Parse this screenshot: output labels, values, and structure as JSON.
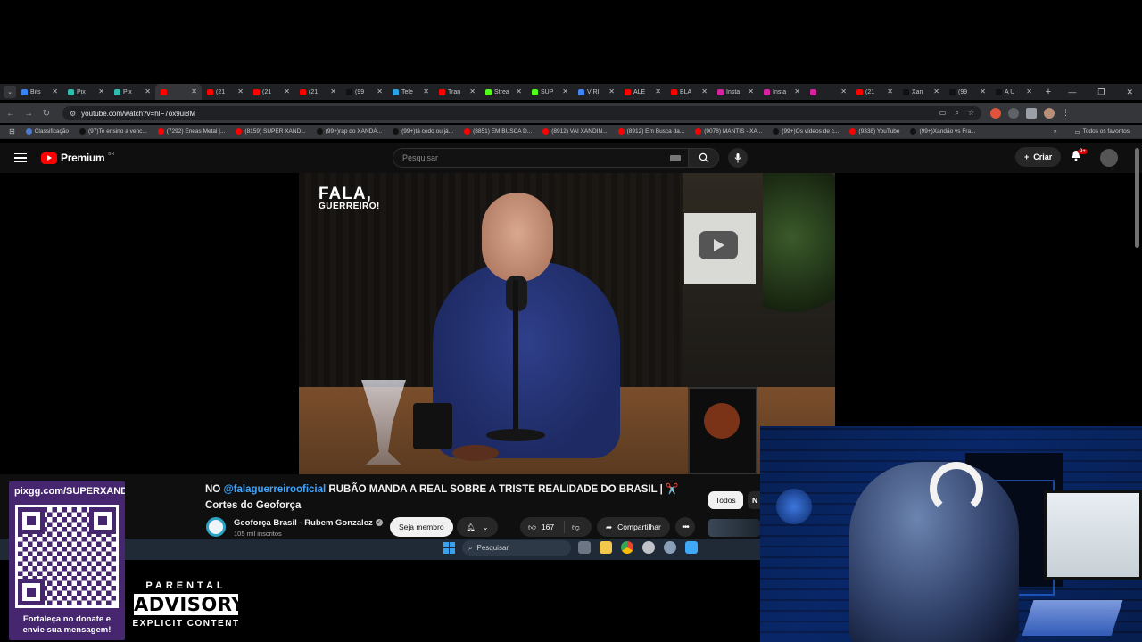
{
  "browser": {
    "tabs": [
      {
        "label": "Bits",
        "fav": "#3b82f6"
      },
      {
        "label": "Pix",
        "fav": "#32bcad"
      },
      {
        "label": "Pix",
        "fav": "#32bcad"
      },
      {
        "label": "",
        "fav": "#ff0000",
        "active": true
      },
      {
        "label": "(21",
        "fav": "#ff0000"
      },
      {
        "label": "(21",
        "fav": "#ff0000"
      },
      {
        "label": "(21",
        "fav": "#ff0000"
      },
      {
        "label": "(99",
        "fav": "#111111"
      },
      {
        "label": "Tele",
        "fav": "#2aa3e0"
      },
      {
        "label": "Tran",
        "fav": "#ff0000"
      },
      {
        "label": "Strea",
        "fav": "#53fc18"
      },
      {
        "label": "SUP",
        "fav": "#53fc18"
      },
      {
        "label": "VIRI",
        "fav": "#4285f4"
      },
      {
        "label": "ALE",
        "fav": "#ff0000"
      },
      {
        "label": "BLA",
        "fav": "#ff0000"
      },
      {
        "label": "Insta",
        "fav": "#d6249f"
      },
      {
        "label": "Insta",
        "fav": "#d6249f"
      },
      {
        "label": "",
        "fav": "#d6249f"
      },
      {
        "label": "(21",
        "fav": "#ff0000"
      },
      {
        "label": "Xan",
        "fav": "#111111"
      },
      {
        "label": "(99",
        "fav": "#111111"
      },
      {
        "label": "A Ú",
        "fav": "#111111"
      }
    ],
    "url": "youtube.com/watch?v=hlF7ox9ui8M",
    "bookmarks": [
      {
        "label": "Classificação",
        "color": "#4a7bd0"
      },
      {
        "label": "(97)Te ensino a venc...",
        "color": "#111111"
      },
      {
        "label": "(7292) Enéas Metal |...",
        "color": "#ff0000"
      },
      {
        "label": "(8159) SUPER XAND...",
        "color": "#ff0000"
      },
      {
        "label": "(99+)rap do XANDÃ...",
        "color": "#111111"
      },
      {
        "label": "(99+)tá cedo ou já...",
        "color": "#111111"
      },
      {
        "label": "(8851) EM BUSCA D...",
        "color": "#ff0000"
      },
      {
        "label": "(8912) VAI XANDIN...",
        "color": "#ff0000"
      },
      {
        "label": "(8912) Em Busca da...",
        "color": "#ff0000"
      },
      {
        "label": "(9078) MANTIS - XA...",
        "color": "#ff0000"
      },
      {
        "label": "(99+)Os vídeos de c...",
        "color": "#111111"
      },
      {
        "label": "(9338) YouTube",
        "color": "#ff0000"
      },
      {
        "label": "(99+)Xandão vs Fra...",
        "color": "#111111"
      }
    ],
    "bookmarks_all": "Todos os favoritos"
  },
  "youtube": {
    "logo": "Premium",
    "logo_region": "BR",
    "search_placeholder": "Pesquisar",
    "create_label": "Criar",
    "notif_badge": "9+",
    "watermark_1": "FALA,",
    "watermark_2": "GUERREIRO!",
    "title_prefix": "NO ",
    "title_mention": "@falaguerreirooficial",
    "title_rest": " RUBÃO MANDA A REAL SOBRE A TRISTE REALIDADE DO BRASIL | ",
    "title_emoji": "✂️",
    "title_line2": "Cortes do Geoforça",
    "channel_name": "Geoforça Brasil - Rubem Gonzalez",
    "subscribers": "105 mil inscritos",
    "member_button": "Seja membro",
    "like_count": "167",
    "share_label": "Compartilhar",
    "chip_all": "Todos",
    "chip_next": "N"
  },
  "taskbar": {
    "search_label": "Pesquisar"
  },
  "overlay": {
    "pix_url": "pixgg.com/SUPERXANDÃ",
    "pix_message_1": "Fortaleça no donate e",
    "pix_message_2": "envie sua mensagem!",
    "advisory_1": "PARENTAL",
    "advisory_2": "ADVISORY",
    "advisory_3": "EXPLICIT CONTENT"
  },
  "colors": {
    "youtube_red": "#ff0000",
    "link_blue": "#3ea6ff",
    "pix_purple": "#46266e"
  }
}
